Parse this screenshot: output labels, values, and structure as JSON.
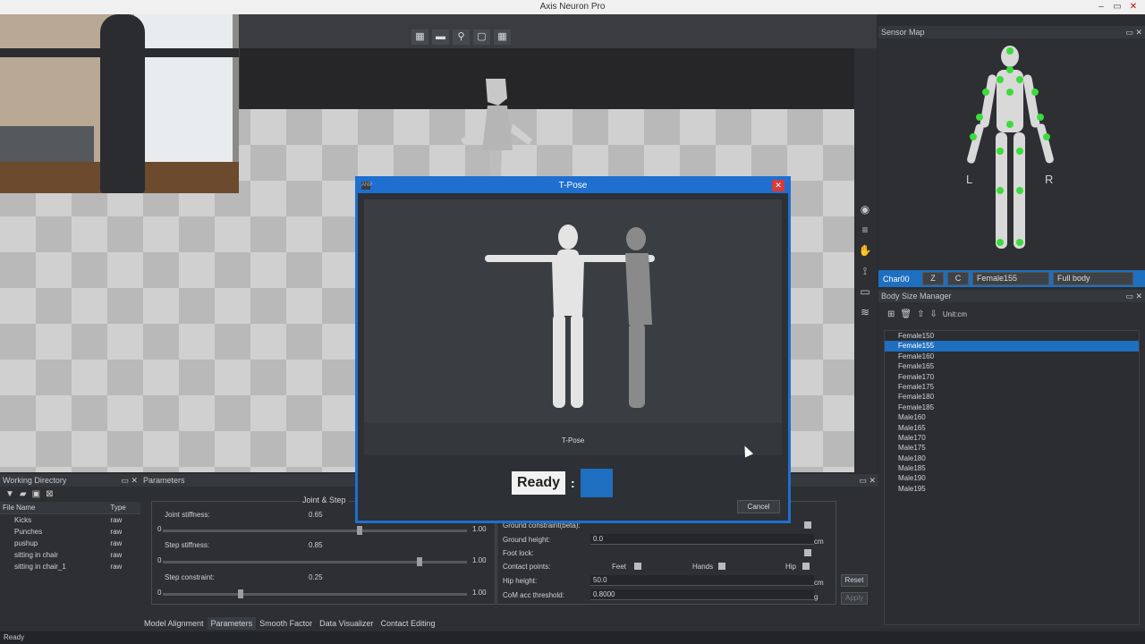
{
  "window": {
    "title": "Axis Neuron Pro",
    "minimize": "–",
    "maximize": "▭",
    "close": "✕"
  },
  "viewport": {
    "tools": [
      "▦",
      "▬",
      "⚲",
      "▢",
      "▦"
    ]
  },
  "sensor_map": {
    "title": "Sensor Map",
    "left": "L",
    "right": "R",
    "panel_buttons": "▭ ✕"
  },
  "char_bar": {
    "name": "Char00",
    "z": "Z",
    "c": "C",
    "size": "Female155",
    "mode": "Full body"
  },
  "body_size_manager": {
    "title": "Body Size Manager",
    "unit": "Unit:cm",
    "sizes": [
      "Female150",
      "Female155",
      "Female160",
      "Female165",
      "Female170",
      "Female175",
      "Female180",
      "Female185",
      "Male160",
      "Male165",
      "Male170",
      "Male175",
      "Male180",
      "Male185",
      "Male190",
      "Male195"
    ],
    "selected": "Female155"
  },
  "working_directory": {
    "title": "Working Directory",
    "col_file": "File Name",
    "col_type": "Type",
    "files": [
      {
        "name": "Kicks",
        "type": "raw"
      },
      {
        "name": "Punches",
        "type": "raw"
      },
      {
        "name": "pushup",
        "type": "raw"
      },
      {
        "name": "sitting in chair",
        "type": "raw"
      },
      {
        "name": "sitting in chair_1",
        "type": "raw"
      }
    ]
  },
  "parameters": {
    "title": "Parameters",
    "group_title": "Joint & Step",
    "joint_stiffness": {
      "label": "Joint stiffness:",
      "value": "0.65",
      "min": "0",
      "max": "1.00",
      "level": 0.65
    },
    "step_stiffness": {
      "label": "Step stiffness:",
      "value": "0.85",
      "min": "0",
      "max": "1.00",
      "level": 0.85
    },
    "step_constraint": {
      "label": "Step constraint:",
      "value": "0.25",
      "min": "0",
      "max": "1.00",
      "level": 0.25
    },
    "ground_constraint": "Ground constraint(beta):",
    "ground_height": {
      "label": "Ground height:",
      "value": "0.0",
      "unit": "cm"
    },
    "foot_lock": "Foot lock:",
    "contact_points": {
      "label": "Contact points:",
      "feet": "Feet",
      "hands": "Hands",
      "hip": "Hip"
    },
    "hip_height": {
      "label": "Hip height:",
      "value": "50.0",
      "unit": "cm"
    },
    "com_threshold": {
      "label": "CoM acc threshold:",
      "value": "0.8000",
      "unit": "g"
    },
    "reset": "Reset",
    "apply": "Apply"
  },
  "tabs": [
    "Model Alignment",
    "Parameters",
    "Smooth Factor",
    "Data Visualizer",
    "Contact Editing"
  ],
  "active_tab": "Parameters",
  "status": "Ready",
  "dialog": {
    "title": "T-Pose",
    "caption": "T-Pose",
    "ready_label": "Ready",
    "colon": ":",
    "cancel": "Cancel",
    "close": "✕",
    "icon": "ANP"
  }
}
